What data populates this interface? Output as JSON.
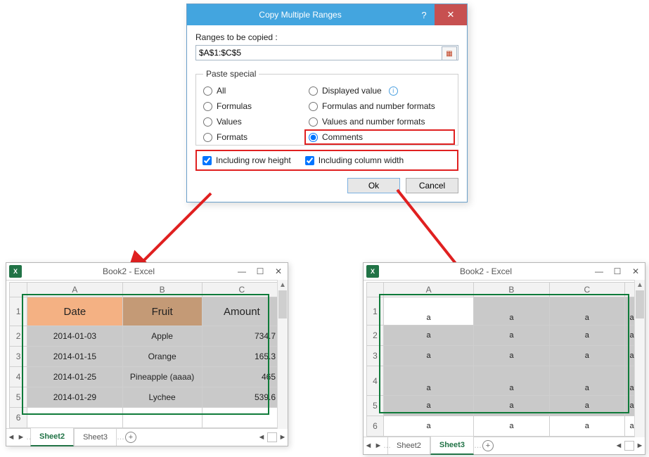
{
  "dialog": {
    "title": "Copy Multiple Ranges",
    "label_ranges": "Ranges to be copied :",
    "range_value": "$A$1:$C$5",
    "fieldset_legend": "Paste special",
    "radio_all": "All",
    "radio_formulas": "Formulas",
    "radio_values": "Values",
    "radio_formats": "Formats",
    "radio_displayed": "Displayed value",
    "radio_formulas_fmt": "Formulas and number formats",
    "radio_values_fmt": "Values and number formats",
    "radio_comments": "Comments",
    "check_row_height": "Including row height",
    "check_col_width": "Including column width",
    "btn_ok": "Ok",
    "btn_cancel": "Cancel"
  },
  "workbook_title": "Book2 - Excel",
  "left": {
    "sheet_active": "Sheet2",
    "sheet_other": "Sheet3",
    "col_A": "A",
    "col_B": "B",
    "col_C": "C",
    "rows": [
      "1",
      "2",
      "3",
      "4",
      "5",
      "6"
    ],
    "hdr_date": "Date",
    "hdr_fruit": "Fruit",
    "hdr_amount": "Amount",
    "c2a": "2014-01-03",
    "c2b": "Apple",
    "c2c": "734.7",
    "c3a": "2014-01-15",
    "c3b": "Orange",
    "c3c": "165.3",
    "c4a": "2014-01-25",
    "c4b": "Pineapple (aaaa)",
    "c4c": "465",
    "c5a": "2014-01-29",
    "c5b": "Lychee",
    "c5c": "539.6"
  },
  "right": {
    "sheet_active": "Sheet3",
    "sheet_other": "Sheet2",
    "col_A": "A",
    "col_B": "B",
    "col_C": "C",
    "rows": [
      "1",
      "2",
      "3",
      "4",
      "5",
      "6"
    ],
    "mark": "a"
  }
}
